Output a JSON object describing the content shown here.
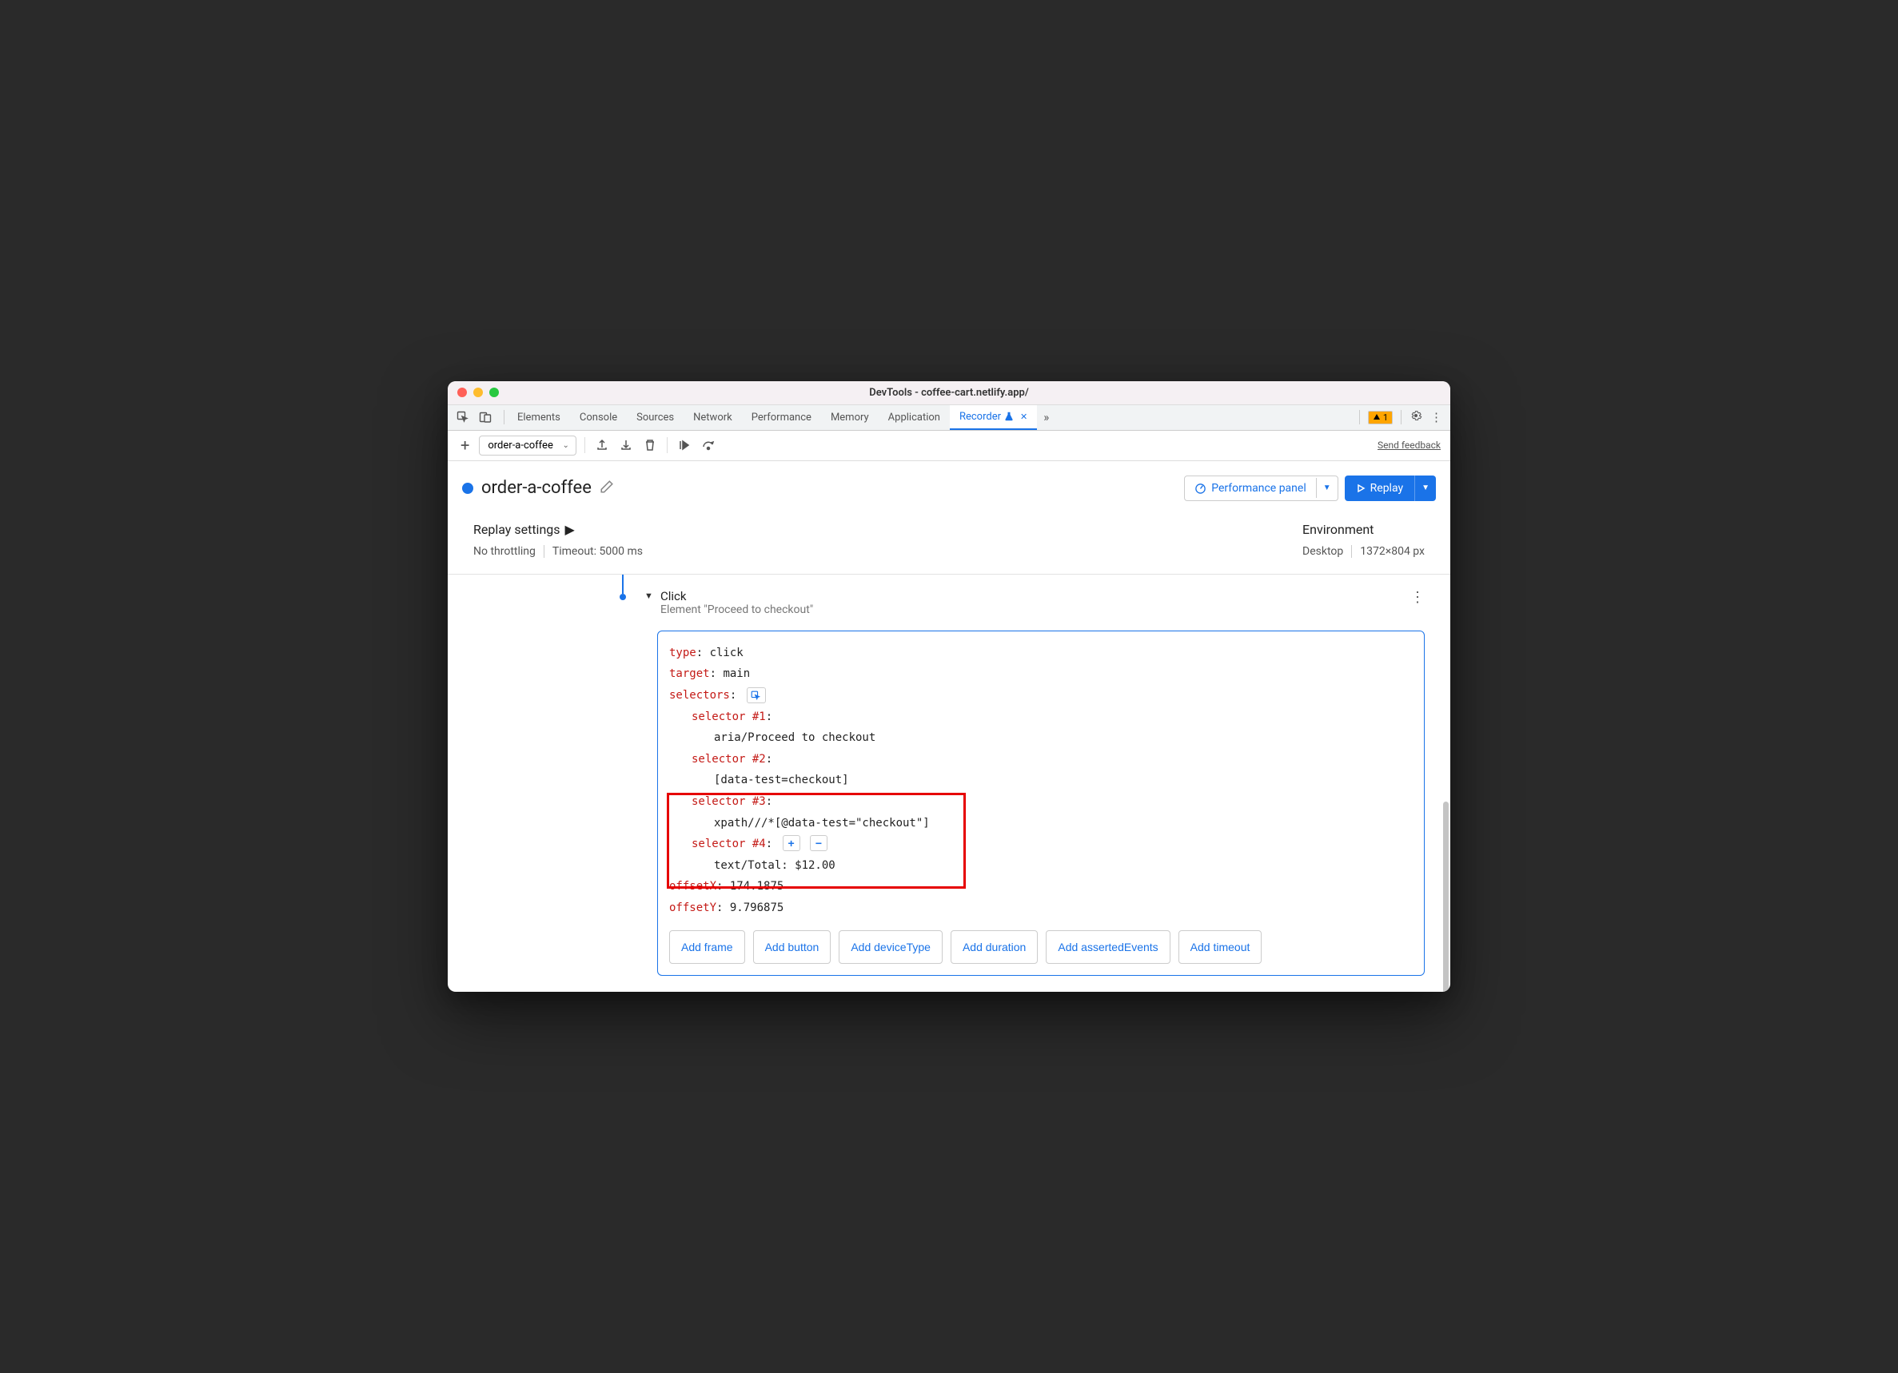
{
  "window_title": "DevTools - coffee-cart.netlify.app/",
  "tabs": {
    "elements": "Elements",
    "console": "Console",
    "sources": "Sources",
    "network": "Network",
    "performance": "Performance",
    "memory": "Memory",
    "application": "Application",
    "recorder": "Recorder"
  },
  "badge_count": "1",
  "toolbar": {
    "recording_name": "order-a-coffee",
    "send_feedback": "Send feedback"
  },
  "header": {
    "title": "order-a-coffee",
    "perf_panel": "Performance panel",
    "replay": "Replay"
  },
  "replay_settings": {
    "title": "Replay settings",
    "throttling": "No throttling",
    "timeout": "Timeout: 5000 ms"
  },
  "environment": {
    "title": "Environment",
    "device": "Desktop",
    "dimensions": "1372×804 px"
  },
  "step": {
    "title": "Click",
    "subtitle": "Element \"Proceed to checkout\"",
    "type_label": "type",
    "type_value": "click",
    "target_label": "target",
    "target_value": "main",
    "selectors_label": "selectors",
    "sel1_label": "selector #1",
    "sel1_value": "aria/Proceed to checkout",
    "sel2_label": "selector #2",
    "sel2_value": "[data-test=checkout]",
    "sel3_label": "selector #3",
    "sel3_value": "xpath///*[@data-test=\"checkout\"]",
    "sel4_label": "selector #4",
    "sel4_value": "text/Total: $12.00",
    "offsetX_label": "offsetX",
    "offsetX_value": "174.1875",
    "offsetY_label": "offsetY",
    "offsetY_value": "9.796875"
  },
  "add_buttons": {
    "frame": "Add frame",
    "button": "Add button",
    "deviceType": "Add deviceType",
    "duration": "Add duration",
    "assertedEvents": "Add assertedEvents",
    "timeout": "Add timeout"
  }
}
